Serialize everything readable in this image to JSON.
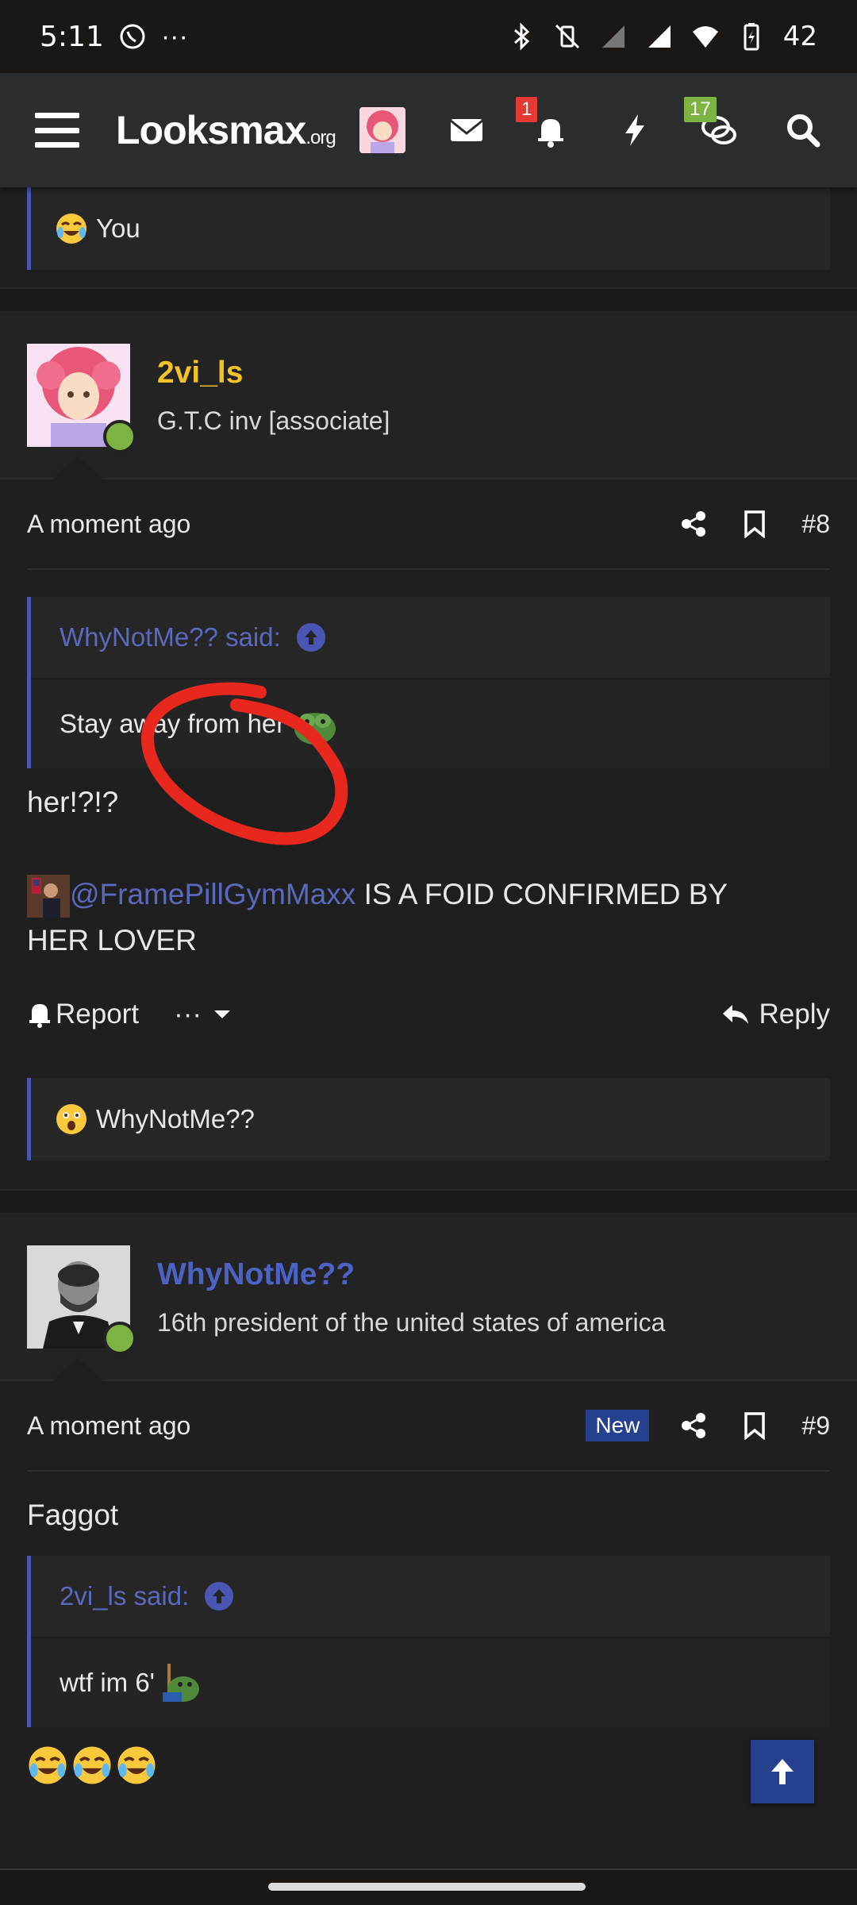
{
  "status_bar": {
    "time": "5:11",
    "more": "···",
    "battery": "42"
  },
  "header": {
    "logo_main": "Looksmax",
    "logo_suffix": ".org",
    "notifications_badge": "1",
    "conversations_badge": "17"
  },
  "top_reaction": {
    "text": "You"
  },
  "posts": [
    {
      "username": "2vi_ls",
      "user_title": "G.T.C inv [associate]",
      "time": "A moment ago",
      "number": "#8",
      "quote_author": "WhyNotMe?? said:",
      "quote_text": "Stay away from her",
      "message_line1": "her!?!?",
      "mention": "@FramePillGymMaxx",
      "message_line2": " IS A FOID CONFIRMED BY",
      "message_line3": "HER LOVER",
      "report_label": "Report",
      "more_label": "···",
      "reply_label": "Reply",
      "reaction_user": "WhyNotMe??"
    },
    {
      "username": "WhyNotMe??",
      "user_title": "16th president of the united states of america",
      "time": "A moment ago",
      "new_label": "New",
      "number": "#9",
      "message": "Faggot",
      "quote_author": "2vi_ls said:",
      "quote_text": "wtf im 6'"
    }
  ],
  "colors": {
    "background": "#1f1f20",
    "accent_blue": "#4b56b4",
    "username_gold": "#f2c229",
    "online_green": "#7cb342",
    "annotation_red": "#e8281e"
  }
}
